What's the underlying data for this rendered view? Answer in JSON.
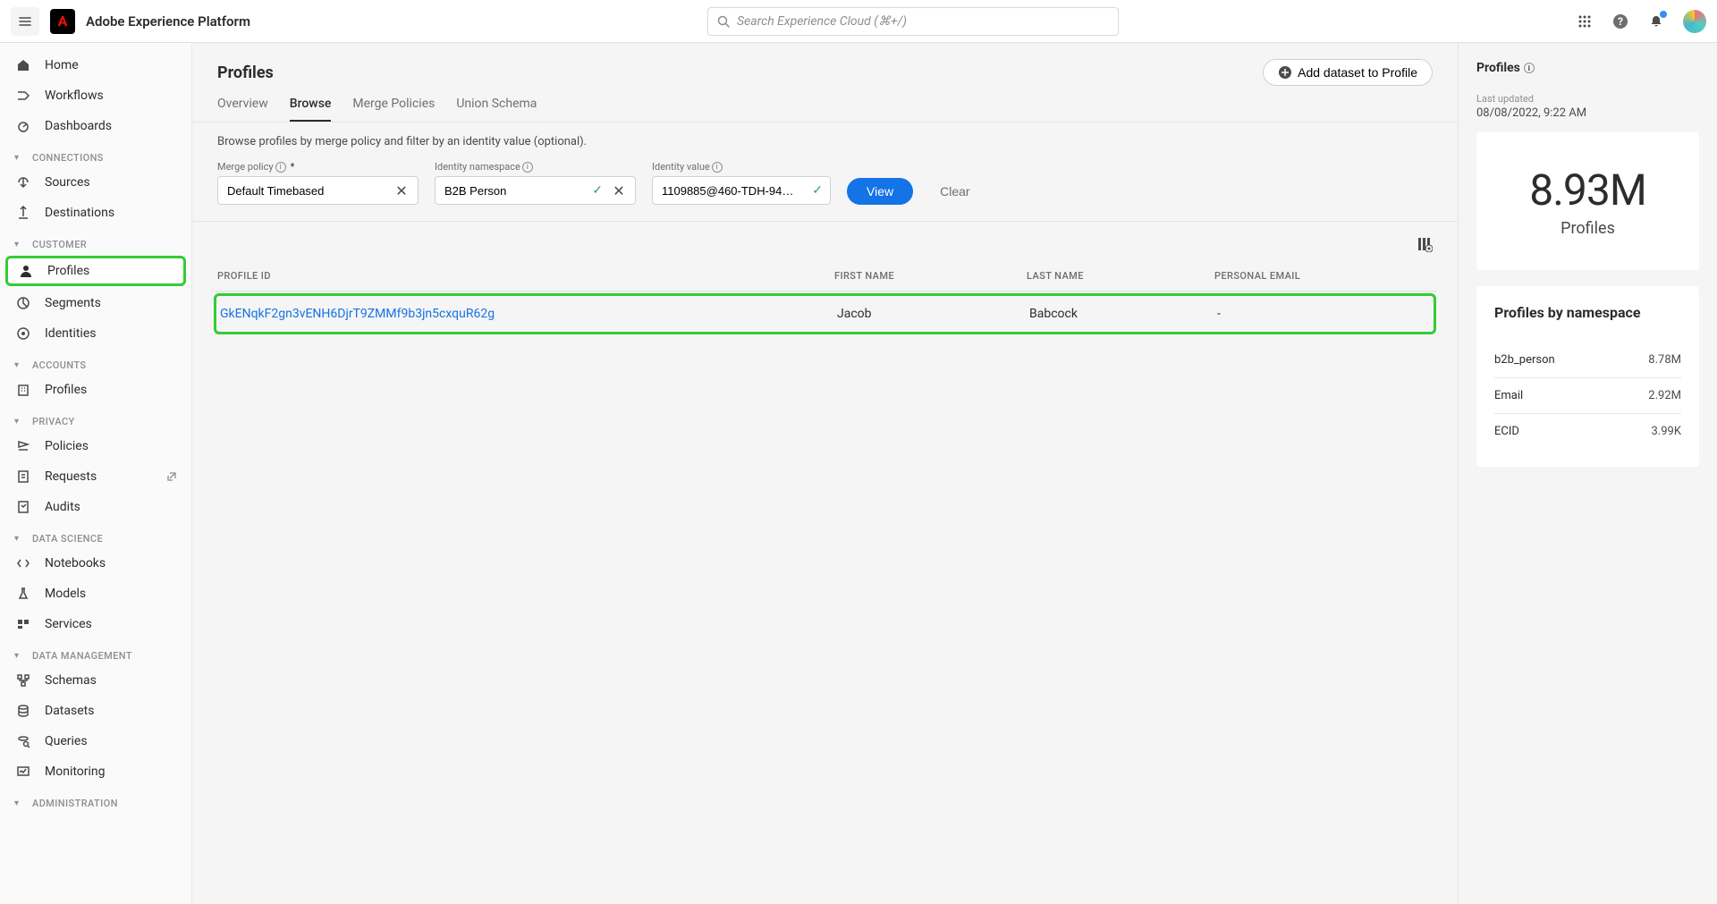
{
  "header": {
    "app_title": "Adobe Experience Platform",
    "search_placeholder": "Search Experience Cloud (⌘+/)"
  },
  "sidebar": {
    "items": [
      {
        "label": "Home"
      },
      {
        "label": "Workflows"
      },
      {
        "label": "Dashboards"
      }
    ],
    "sections": [
      {
        "label": "Connections",
        "items": [
          {
            "label": "Sources"
          },
          {
            "label": "Destinations"
          }
        ]
      },
      {
        "label": "Customer",
        "items": [
          {
            "label": "Profiles",
            "active": true
          },
          {
            "label": "Segments"
          },
          {
            "label": "Identities"
          }
        ]
      },
      {
        "label": "Accounts",
        "items": [
          {
            "label": "Profiles"
          }
        ]
      },
      {
        "label": "Privacy",
        "items": [
          {
            "label": "Policies"
          },
          {
            "label": "Requests",
            "external": true
          },
          {
            "label": "Audits"
          }
        ]
      },
      {
        "label": "Data Science",
        "items": [
          {
            "label": "Notebooks"
          },
          {
            "label": "Models"
          },
          {
            "label": "Services"
          }
        ]
      },
      {
        "label": "Data Management",
        "items": [
          {
            "label": "Schemas"
          },
          {
            "label": "Datasets"
          },
          {
            "label": "Queries"
          },
          {
            "label": "Monitoring"
          }
        ]
      },
      {
        "label": "Administration",
        "items": []
      }
    ]
  },
  "page": {
    "title": "Profiles",
    "add_dataset_label": "Add dataset to Profile",
    "tabs": [
      {
        "label": "Overview"
      },
      {
        "label": "Browse",
        "active": true
      },
      {
        "label": "Merge Policies"
      },
      {
        "label": "Union Schema"
      }
    ],
    "browse_desc": "Browse profiles by merge policy and filter by an identity value (optional).",
    "filters": {
      "merge_policy": {
        "label": "Merge policy",
        "value": "Default Timebased",
        "required": true
      },
      "identity_namespace": {
        "label": "Identity namespace",
        "value": "B2B Person"
      },
      "identity_value": {
        "label": "Identity value",
        "value": "1109885@460-TDH-94…"
      },
      "view_label": "View",
      "clear_label": "Clear"
    },
    "table": {
      "columns": [
        "Profile ID",
        "First Name",
        "Last Name",
        "Personal Email"
      ],
      "rows": [
        {
          "id": "GkENqkF2gn3vENH6DjrT9ZMMf9b3jn5cxquR62g",
          "first_name": "Jacob",
          "last_name": "Babcock",
          "email": "-"
        }
      ]
    }
  },
  "right_panel": {
    "title": "Profiles",
    "last_updated_label": "Last updated",
    "last_updated": "08/08/2022, 9:22 AM",
    "stat_number": "8.93M",
    "stat_label": "Profiles",
    "namespace_title": "Profiles by namespace",
    "namespaces": [
      {
        "name": "b2b_person",
        "count": "8.78M"
      },
      {
        "name": "Email",
        "count": "2.92M"
      },
      {
        "name": "ECID",
        "count": "3.99K"
      }
    ]
  }
}
